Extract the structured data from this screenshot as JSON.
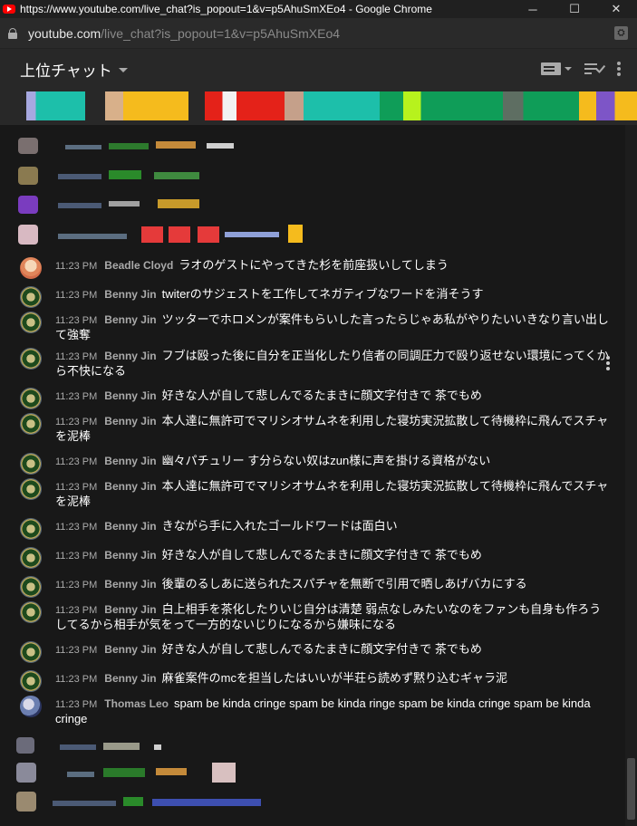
{
  "window": {
    "title": "https://www.youtube.com/live_chat?is_popout=1&v=p5AhuSmXEo4 - Google Chrome",
    "minimize": "─",
    "maximize": "☐",
    "close": "✕"
  },
  "address": {
    "host": "youtube.com",
    "path": "/live_chat?is_popout=1&v=p5AhuSmXEo4"
  },
  "chat_header": {
    "title": "上位チャット"
  },
  "messages": [
    {
      "time": "11:23 PM",
      "author": "Beadle Cloyd",
      "text": "ラオのゲストにやってきた杉を前座扱いしてしまう",
      "avatar": "girl"
    },
    {
      "time": "11:23 PM",
      "author": "Benny Jin",
      "text": "twiterのサジェストを工作してネガティブなワードを消そうす",
      "avatar": "green"
    },
    {
      "time": "11:23 PM",
      "author": "Benny Jin",
      "text": "ツッターでホロメンが案件もらいした言ったらじゃあ私がやりたいいきなり言い出して強奪",
      "avatar": "green"
    },
    {
      "time": "11:23 PM",
      "author": "Benny Jin",
      "text": "フブは殴った後に自分を正当化したり信者の同調圧力で殴り返せない環境にってくから不快になる",
      "avatar": "green"
    },
    {
      "time": "11:23 PM",
      "author": "Benny Jin",
      "text": "好きな人が自して悲しんでるたまきに顔文字付きで 茶でもめ",
      "avatar": "green"
    },
    {
      "time": "11:23 PM",
      "author": "Benny Jin",
      "text": "本人達に無許可でマリシオサムネを利用した寝坊実況拡散して待機枠に飛んでスチャを泥棒",
      "avatar": "green"
    },
    {
      "time": "11:23 PM",
      "author": "Benny Jin",
      "text": "幽々パチュリー す分らない奴はzun様に声を掛ける資格がない",
      "avatar": "green"
    },
    {
      "time": "11:23 PM",
      "author": "Benny Jin",
      "text": "本人達に無許可でマリシオサムネを利用した寝坊実況拡散して待機枠に飛んでスチャを泥棒",
      "avatar": "green"
    },
    {
      "time": "11:23 PM",
      "author": "Benny Jin",
      "text": "きながら手に入れたゴールドワードは面白い",
      "avatar": "green"
    },
    {
      "time": "11:23 PM",
      "author": "Benny Jin",
      "text": "好きな人が自して悲しんでるたまきに顔文字付きで 茶でもめ",
      "avatar": "green"
    },
    {
      "time": "11:23 PM",
      "author": "Benny Jin",
      "text": "後輩のるしあに送られたスパチャを無断で引用で晒しあげバカにする",
      "avatar": "green"
    },
    {
      "time": "11:23 PM",
      "author": "Benny Jin",
      "text": "白上相手を茶化したりいじ自分は清楚 弱点なしみたいなのをファンも自身も作ろうしてるから相手が気をって一方的ないじりになるから嫌味になる",
      "avatar": "green"
    },
    {
      "time": "11:23 PM",
      "author": "Benny Jin",
      "text": "好きな人が自して悲しんでるたまきに顔文字付きで 茶でもめ",
      "avatar": "green"
    },
    {
      "time": "11:23 PM",
      "author": "Benny Jin",
      "text": "麻雀案件のmcを担当したはいいが半荘ら読めず黙り込むギャラ泥",
      "avatar": "green"
    },
    {
      "time": "11:23 PM",
      "author": "Thomas Leo",
      "text": "spam be kinda cringe spam be kinda ringe spam be kinda cringe spam be kinda cringe",
      "avatar": "thomas"
    }
  ]
}
